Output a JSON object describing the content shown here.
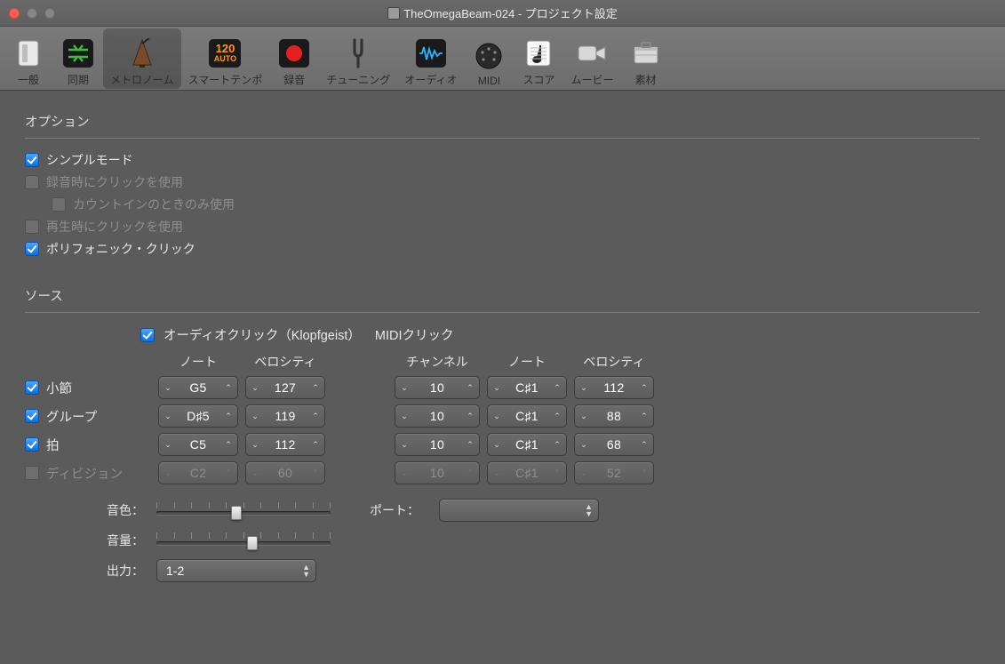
{
  "window": {
    "title": "TheOmegaBeam-024 - プロジェクト設定"
  },
  "toolbar": {
    "items": [
      {
        "key": "general",
        "label": "一般"
      },
      {
        "key": "sync",
        "label": "同期"
      },
      {
        "key": "metronome",
        "label": "メトロノーム"
      },
      {
        "key": "smarttempo",
        "label": "スマートテンポ"
      },
      {
        "key": "record",
        "label": "録音"
      },
      {
        "key": "tuning",
        "label": "チューニング"
      },
      {
        "key": "audio",
        "label": "オーディオ"
      },
      {
        "key": "midi",
        "label": "MIDI"
      },
      {
        "key": "score",
        "label": "スコア"
      },
      {
        "key": "movie",
        "label": "ムービー"
      },
      {
        "key": "assets",
        "label": "素材"
      }
    ],
    "active": "metronome",
    "smarttempo_badge_top": "120",
    "smarttempo_badge_bottom": "AUTO"
  },
  "sections": {
    "options_title": "オプション",
    "source_title": "ソース"
  },
  "options": {
    "simple_mode": {
      "label": "シンプルモード",
      "checked": true,
      "enabled": true
    },
    "click_on_record": {
      "label": "録音時にクリックを使用",
      "checked": false,
      "enabled": false
    },
    "count_in_only": {
      "label": "カウントインのときのみ使用",
      "checked": false,
      "enabled": false
    },
    "click_on_play": {
      "label": "再生時にクリックを使用",
      "checked": false,
      "enabled": false
    },
    "polyphonic_click": {
      "label": "ポリフォニック・クリック",
      "checked": true,
      "enabled": true
    }
  },
  "source_header": {
    "audio_click": {
      "label": "オーディオクリック（Klopfgeist）",
      "checked": true
    },
    "midi_click_label": "MIDIクリック"
  },
  "col_headers": {
    "note": "ノート",
    "velocity": "ベロシティ",
    "channel": "チャンネル",
    "note2": "ノート",
    "velocity2": "ベロシティ"
  },
  "rows": {
    "bar": {
      "label": "小節",
      "checked": true,
      "enabled": true,
      "note": "G5",
      "vel": "127",
      "chan": "10",
      "note2": "C♯1",
      "vel2": "112"
    },
    "group": {
      "label": "グループ",
      "checked": true,
      "enabled": true,
      "note": "D♯5",
      "vel": "119",
      "chan": "10",
      "note2": "C♯1",
      "vel2": "88"
    },
    "beat": {
      "label": "拍",
      "checked": true,
      "enabled": true,
      "note": "C5",
      "vel": "112",
      "chan": "10",
      "note2": "C♯1",
      "vel2": "68"
    },
    "division": {
      "label": "ディビジョン",
      "checked": false,
      "enabled": false,
      "note": "C2",
      "vel": "60",
      "chan": "10",
      "note2": "C♯1",
      "vel2": "52"
    }
  },
  "bottom": {
    "tone_label": "音色：",
    "tone_pct": 46,
    "volume_label": "音量：",
    "volume_pct": 55,
    "port_label": "ポート：",
    "port_value": "",
    "output_label": "出力：",
    "output_value": "1-2"
  }
}
